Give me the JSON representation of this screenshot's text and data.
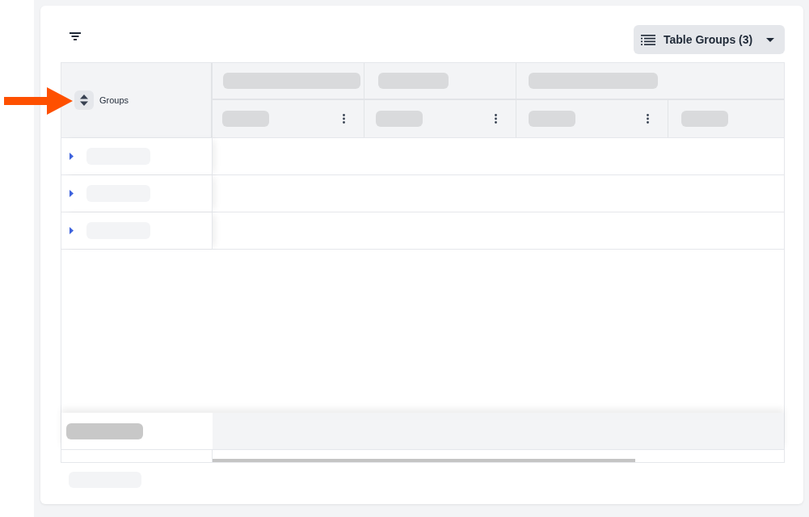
{
  "toolbar": {
    "groups_button": {
      "label": "Table Groups (3)"
    }
  },
  "table": {
    "group_column": {
      "label": "Groups"
    },
    "rows": [
      {
        "expanded": false
      },
      {
        "expanded": false
      },
      {
        "expanded": false
      }
    ]
  }
}
